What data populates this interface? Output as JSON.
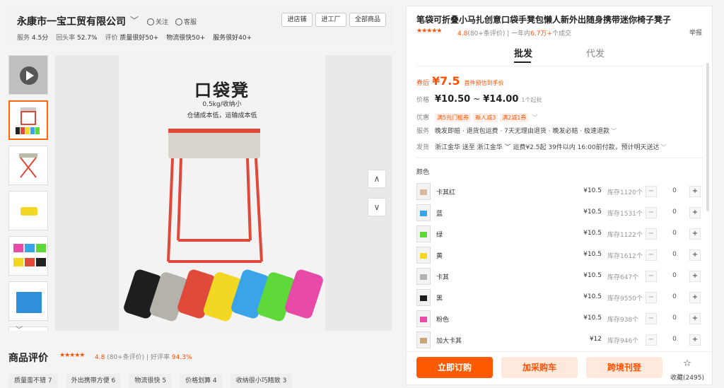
{
  "shop": {
    "name": "永康市一宝工贸有限公司",
    "caret": "﹀",
    "follow": "关注",
    "service": "客服",
    "buttons": [
      "进店铺",
      "进工厂",
      "全部商品"
    ],
    "stats": [
      {
        "label": "服务",
        "value": "4.5分"
      },
      {
        "label": "回头率",
        "value": "52.7%"
      },
      {
        "label": "评价",
        "value": "质量很好50+"
      },
      {
        "label": "",
        "value": "物流很快50+"
      },
      {
        "label": "",
        "value": "服务很好40+"
      }
    ]
  },
  "gallery": {
    "image_title": "口袋凳",
    "image_sub1": "0.5kg/收纳小",
    "image_sub2": "仓储成本低，运输成本低",
    "nav_up": "∧",
    "nav_down": "∨",
    "thumbs_down": "﹀",
    "pouch_colors": [
      "#1e1e1e",
      "#b5b2ab",
      "#e04a3a",
      "#f2d822",
      "#3aa4e8",
      "#5fd83a",
      "#e84aa8"
    ]
  },
  "reviews": {
    "title": "商品评价",
    "stars": "★★★★★",
    "score": "4.8",
    "count": "(80+条评价)",
    "good_label": "好评率",
    "good_rate": "94.3%",
    "tags": [
      "质量蛮不错 7",
      "外出携带方便 6",
      "物流很快 5",
      "价格划算 4",
      "收纳很小巧精致 3"
    ]
  },
  "product": {
    "title": "笔袋可折叠小马扎创意口袋手凳包懒人新外出随身携带迷你椅子凳子",
    "stars": "★★★★★",
    "score": "4.8",
    "reviews": "(80+条评价)",
    "sold_prefix": "一年内",
    "sold_value": "6.7万+",
    "sold_suffix": "个成交",
    "report": "举报",
    "tabs": [
      "批发",
      "代发"
    ],
    "promo_label": "券后",
    "promo_price": "¥7.5",
    "promo_note": "首件预估到手价",
    "price_label": "价格",
    "price_low": "¥10.50",
    "price_sep": "~",
    "price_high": "¥14.00",
    "price_min": "1个起批",
    "coupon_label": "优惠",
    "coupons": [
      "满5元门槛券",
      "新人减3",
      "满2减1券"
    ],
    "service_label": "服务",
    "services": "晚发即赔 · 退货包运费 · 7天无理由退货 · 晚发必赔 · 极速退款",
    "ship_label": "发货",
    "ship": "浙江金华 送至 浙江金华 ﹀   运费¥2.5起  39件以内  16:00前付款，预计明天送达",
    "color_label": "颜色",
    "variants": [
      {
        "name": "卡其红",
        "price": "¥10.5",
        "stock": "库存1120个",
        "qty": "0",
        "color": "#d9b9a0"
      },
      {
        "name": "蓝",
        "price": "¥10.5",
        "stock": "库存1531个",
        "qty": "0",
        "color": "#3aa4e8"
      },
      {
        "name": "绿",
        "price": "¥10.5",
        "stock": "库存1122个",
        "qty": "0",
        "color": "#5fd83a"
      },
      {
        "name": "黄",
        "price": "¥10.5",
        "stock": "库存1612个",
        "qty": "0",
        "color": "#f2d822"
      },
      {
        "name": "卡其",
        "price": "¥10.5",
        "stock": "库存647个",
        "qty": "0",
        "color": "#b5b2ab"
      },
      {
        "name": "黑",
        "price": "¥10.5",
        "stock": "库存9550个",
        "qty": "0",
        "color": "#1e1e1e"
      },
      {
        "name": "粉色",
        "price": "¥10.5",
        "stock": "库存938个",
        "qty": "0",
        "color": "#e84aa8"
      },
      {
        "name": "加大卡其",
        "price": "¥12",
        "stock": "库存946个",
        "qty": "0",
        "color": "#c9a57a"
      }
    ],
    "minus": "−",
    "plus": "+",
    "order_btn": "立即订购",
    "cart_btn": "加采购车",
    "cross_btn": "跨境刊登",
    "fav_icon": "☆",
    "fav_label": "收藏(2495)"
  },
  "colors": {
    "accent": "#ff5000",
    "order": "#ff5a00",
    "light": "#ffe8dc"
  }
}
